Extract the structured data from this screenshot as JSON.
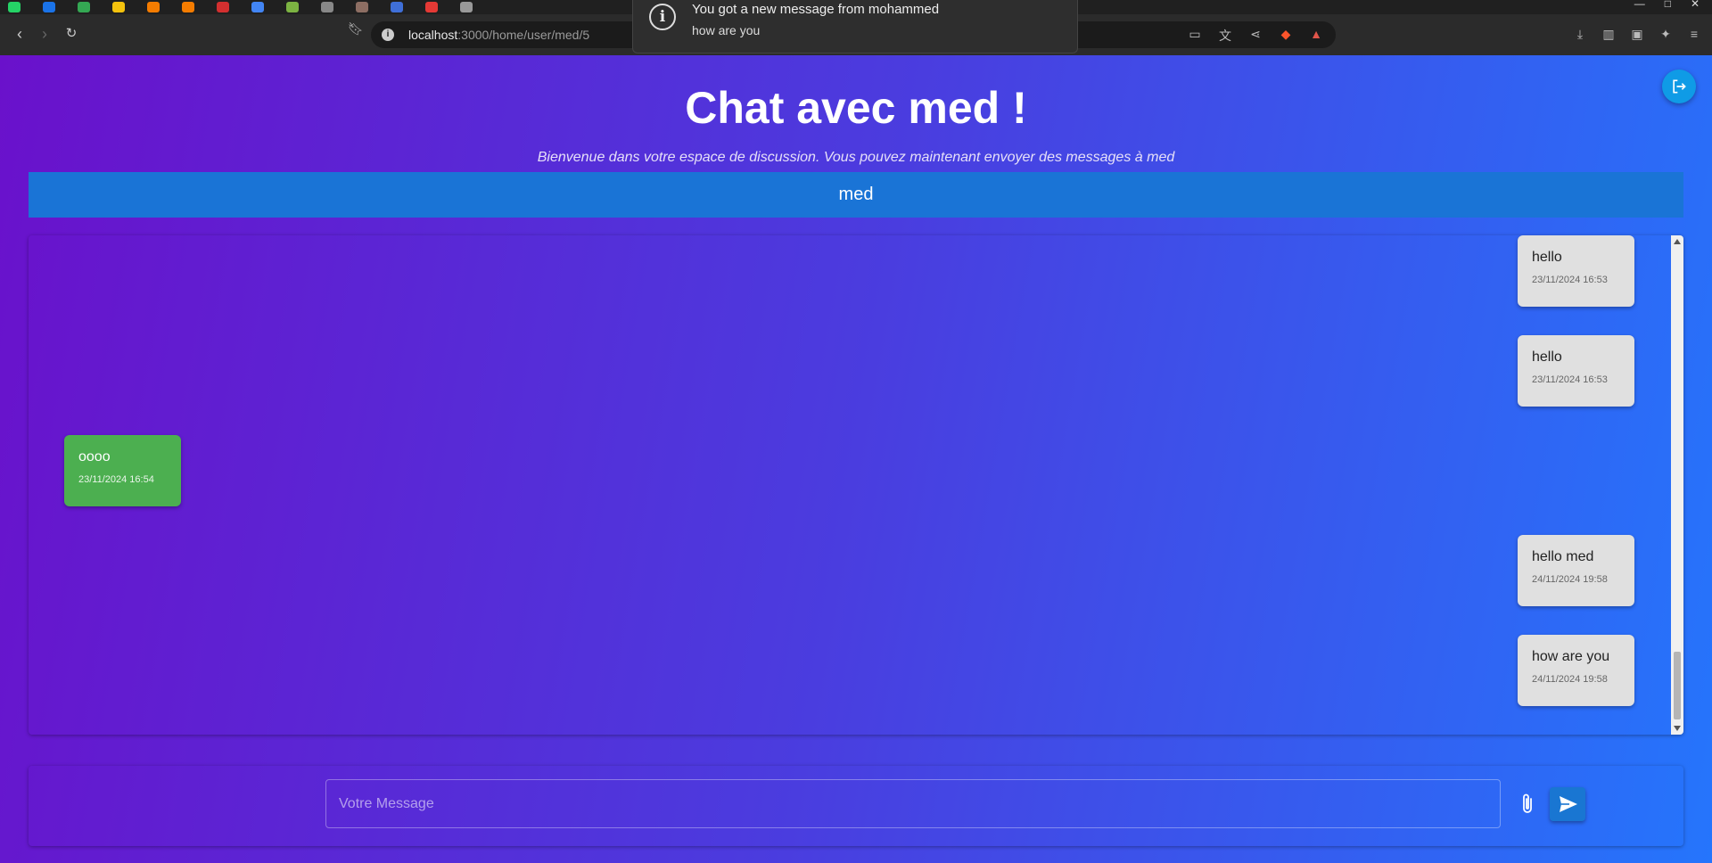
{
  "browser": {
    "url_host": "localhost",
    "url_path": ":3000/home/user/med/5"
  },
  "notification": {
    "title": "You got a new message from mohammed",
    "body": "how are you"
  },
  "page": {
    "title": "Chat avec med !",
    "subtitle": "Bienvenue dans votre espace de discussion. Vous pouvez maintenant envoyer des messages à med",
    "recipient": "med"
  },
  "messages": [
    {
      "text": "hello",
      "time": "23/11/2024 16:53",
      "direction": "sent"
    },
    {
      "text": "hello",
      "time": "23/11/2024 16:53",
      "direction": "sent"
    },
    {
      "text": "oooo",
      "time": "23/11/2024 16:54",
      "direction": "received"
    },
    {
      "text": "hello med",
      "time": "24/11/2024 19:58",
      "direction": "sent"
    },
    {
      "text": "how are you",
      "time": "24/11/2024 19:58",
      "direction": "sent"
    }
  ],
  "composer": {
    "placeholder": "Votre Message",
    "value": ""
  },
  "colors": {
    "gradient_start": "#6a11cb",
    "gradient_end": "#2575fc",
    "recipient_bar": "#1a74d6",
    "sent_bubble": "#e0e0e0",
    "received_bubble": "#4caf50",
    "send_button": "#1976d2",
    "logout_button": "#0f9be6"
  },
  "icons": {
    "logout": "logout-icon",
    "attach": "paperclip-icon",
    "send": "send-icon",
    "notification": "info-icon"
  }
}
